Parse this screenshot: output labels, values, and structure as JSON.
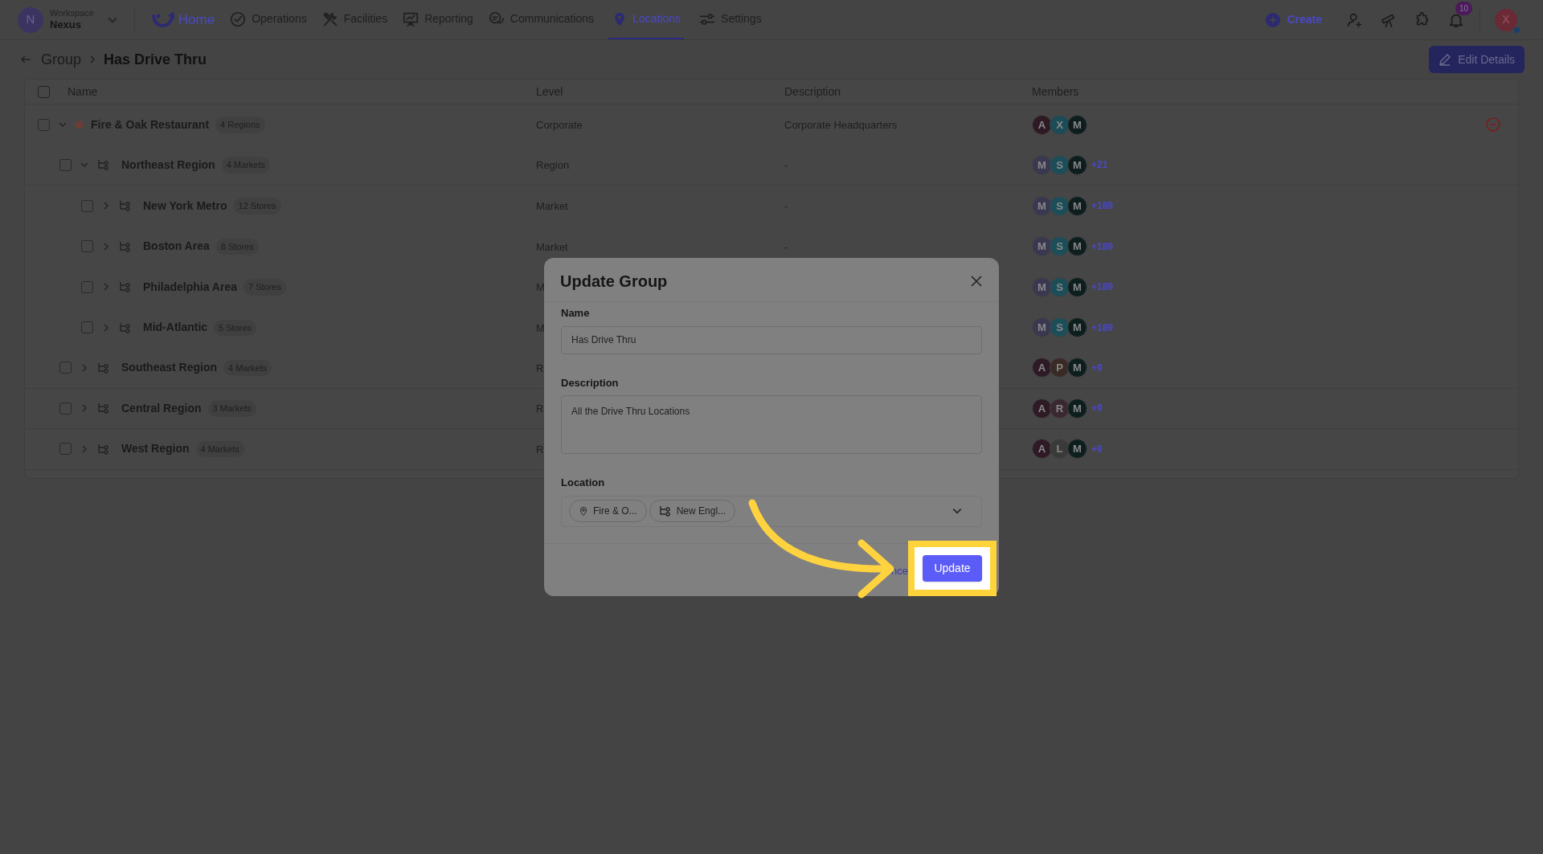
{
  "nav": {
    "workspace": {
      "label": "Workspace",
      "name": "Nexus",
      "initial": "N"
    },
    "items": [
      {
        "label": "Home",
        "selected": false,
        "kind": "brand"
      },
      {
        "label": "Operations",
        "selected": false,
        "kind": "link"
      },
      {
        "label": "Facilities",
        "selected": false,
        "kind": "link"
      },
      {
        "label": "Reporting",
        "selected": false,
        "kind": "link"
      },
      {
        "label": "Communications",
        "selected": false,
        "kind": "link"
      },
      {
        "label": "Locations",
        "selected": true,
        "kind": "link"
      },
      {
        "label": "Settings",
        "selected": false,
        "kind": "link"
      }
    ],
    "create": "Create",
    "notification_count": "10",
    "avatar": "X"
  },
  "breadcrumb": {
    "parent": "Group",
    "current": "Has Drive Thru"
  },
  "edit_button": "Edit Details",
  "table": {
    "all_checked": false,
    "columns": [
      "Name",
      "Level",
      "Description",
      "Members"
    ],
    "rows": [
      {
        "name": "Fire & Oak Restaurant",
        "count": "4 Regions",
        "level": "Corporate",
        "description": "Corporate Headquarters",
        "kind": "org",
        "expanded": true,
        "checked": false,
        "removable": true,
        "members": [
          {
            "initial": "A",
            "color": "#2e1a24"
          },
          {
            "initial": "X",
            "color": "#1b4c58"
          },
          {
            "initial": "M",
            "color": "#0e1e1e"
          }
        ],
        "children": [
          {
            "name": "Northeast Region",
            "count": "4 Markets",
            "level": "Region",
            "description": "-",
            "kind": "group",
            "expanded": true,
            "checked": false,
            "more": "+21",
            "members": [
              {
                "initial": "M",
                "color": "#3a3850"
              },
              {
                "initial": "S",
                "color": "#1c4e5a"
              },
              {
                "initial": "M",
                "color": "#0e1e1e"
              }
            ],
            "children": [
              {
                "name": "New York Metro",
                "count": "12 Stores",
                "level": "Market",
                "description": "-",
                "kind": "group",
                "expanded": false,
                "checked": false,
                "more": "+189",
                "members": [
                  {
                    "initial": "M",
                    "color": "#3a3850"
                  },
                  {
                    "initial": "S",
                    "color": "#1c4e5a"
                  },
                  {
                    "initial": "M",
                    "color": "#0e1e1e"
                  }
                ]
              },
              {
                "name": "Boston Area",
                "count": "8 Stores",
                "level": "Market",
                "description": "-",
                "kind": "group",
                "expanded": false,
                "checked": false,
                "more": "+189",
                "members": [
                  {
                    "initial": "M",
                    "color": "#3a3850"
                  },
                  {
                    "initial": "S",
                    "color": "#1c4e5a"
                  },
                  {
                    "initial": "M",
                    "color": "#0e1e1e"
                  }
                ]
              },
              {
                "name": "Philadelphia Area",
                "count": "7 Stores",
                "level": "M",
                "kind": "group",
                "expanded": false,
                "checked": false,
                "more": "+189",
                "members": [
                  {
                    "initial": "M",
                    "color": "#3a3850"
                  },
                  {
                    "initial": "S",
                    "color": "#1c4e5a"
                  },
                  {
                    "initial": "M",
                    "color": "#0e1e1e"
                  }
                ]
              },
              {
                "name": "Mid-Atlantic",
                "count": "5 Stores",
                "level": "M",
                "kind": "group",
                "expanded": false,
                "checked": false,
                "more": "+189",
                "members": [
                  {
                    "initial": "M",
                    "color": "#3a3850"
                  },
                  {
                    "initial": "S",
                    "color": "#1c4e5a"
                  },
                  {
                    "initial": "M",
                    "color": "#0e1e1e"
                  }
                ]
              }
            ]
          },
          {
            "name": "Southeast Region",
            "count": "4 Markets",
            "level": "R",
            "kind": "group",
            "expanded": false,
            "checked": false,
            "more": "+9",
            "members": [
              {
                "initial": "A",
                "color": "#2e1a24"
              },
              {
                "initial": "P",
                "color": "#3a2a26"
              },
              {
                "initial": "M",
                "color": "#0e1e1e"
              }
            ]
          },
          {
            "name": "Central Region",
            "count": "3 Markets",
            "level": "R",
            "kind": "group",
            "expanded": false,
            "checked": false,
            "more": "+9",
            "members": [
              {
                "initial": "A",
                "color": "#2e1a24"
              },
              {
                "initial": "R",
                "color": "#3a2830"
              },
              {
                "initial": "M",
                "color": "#0e1e1e"
              }
            ]
          },
          {
            "name": "West Region",
            "count": "4 Markets",
            "level": "R",
            "kind": "group",
            "expanded": false,
            "checked": false,
            "more": "+9",
            "members": [
              {
                "initial": "A",
                "color": "#2e1a24"
              },
              {
                "initial": "L",
                "color": "#3a3a3a"
              },
              {
                "initial": "M",
                "color": "#0e1e1e"
              }
            ]
          }
        ]
      }
    ]
  },
  "modal": {
    "title": "Update Group",
    "fields": [
      {
        "kind": "input",
        "label": "Name",
        "value": "Has Drive Thru"
      },
      {
        "kind": "textarea",
        "label": "Description",
        "value": "All the Drive Thru Locations"
      },
      {
        "kind": "select",
        "label": "Location",
        "chips": [
          {
            "label": "Fire & O..."
          },
          {
            "label": "New Engl..."
          }
        ]
      }
    ],
    "cancel": "nce",
    "submit": "Update"
  }
}
